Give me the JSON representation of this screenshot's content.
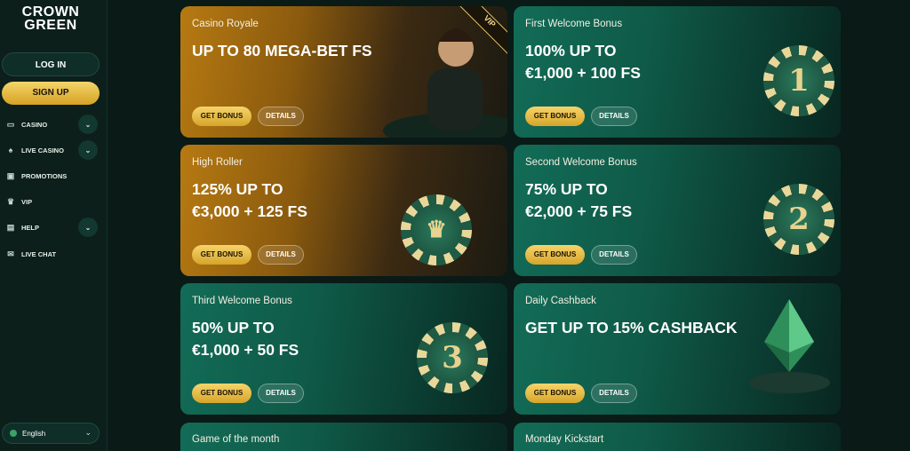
{
  "sidebar": {
    "logo_line1": "CROWN",
    "logo_line2": "GREEN",
    "login_label": "LOG IN",
    "signup_label": "SIGN UP",
    "items": [
      {
        "label": "CASINO",
        "icon": "casino-icon",
        "expandable": true
      },
      {
        "label": "LIVE CASINO",
        "icon": "live-casino-icon",
        "expandable": true
      },
      {
        "label": "PROMOTIONS",
        "icon": "gift-icon",
        "expandable": false
      },
      {
        "label": "VIP",
        "icon": "crown-icon",
        "expandable": false
      },
      {
        "label": "HELP",
        "icon": "help-icon",
        "expandable": true
      },
      {
        "label": "LIVE CHAT",
        "icon": "chat-icon",
        "expandable": false
      }
    ],
    "language": "English"
  },
  "cards": [
    {
      "subtitle": "Casino Royale",
      "headline_line1": "UP TO 80 MEGA-BET FS",
      "headline_line2": "",
      "get_bonus": "GET BONUS",
      "details": "DETAILS",
      "badge": "VIP"
    },
    {
      "subtitle": "First Welcome Bonus",
      "headline_line1": "100% UP TO",
      "headline_line2": "€1,000 + 100 FS",
      "get_bonus": "GET BONUS",
      "details": "DETAILS",
      "chip_number": "1"
    },
    {
      "subtitle": "High Roller",
      "headline_line1": "125% UP TO",
      "headline_line2": "€3,000 + 125 FS",
      "get_bonus": "GET BONUS",
      "details": "DETAILS"
    },
    {
      "subtitle": "Second Welcome Bonus",
      "headline_line1": "75% UP TO",
      "headline_line2": "€2,000 + 75 FS",
      "get_bonus": "GET BONUS",
      "details": "DETAILS",
      "chip_number": "2"
    },
    {
      "subtitle": "Third Welcome Bonus",
      "headline_line1": "50% UP TO",
      "headline_line2": "€1,000 + 50 FS",
      "get_bonus": "GET BONUS",
      "details": "DETAILS",
      "chip_number": "3"
    },
    {
      "subtitle": "Daily Cashback",
      "headline_line1": "GET UP TO 15% CASHBACK",
      "headline_line2": "",
      "get_bonus": "GET BONUS",
      "details": "DETAILS"
    },
    {
      "subtitle": "Game of the month"
    },
    {
      "subtitle": "Monday Kickstart"
    }
  ],
  "colors": {
    "accent_gold": "#d6a52a",
    "bg": "#0a1a16",
    "card_green": "#126c57",
    "card_gold": "#b77a12"
  }
}
